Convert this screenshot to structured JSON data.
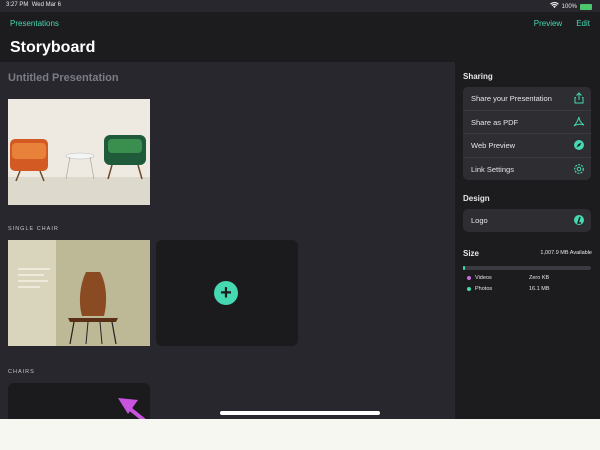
{
  "status": {
    "time": "3:27 PM",
    "date": "Wed Mar 6",
    "battery": "100%"
  },
  "nav": {
    "back_label": "Presentations",
    "preview_label": "Preview",
    "edit_label": "Edit",
    "title": "Storyboard"
  },
  "document": {
    "title": "Untitled Presentation",
    "sections": [
      {
        "label": "SINGLE CHAIR"
      },
      {
        "label": "CHAIRS"
      }
    ],
    "add_label": "+"
  },
  "sidebar": {
    "sharing_heading": "Sharing",
    "sharing_items": [
      {
        "label": "Share your Presentation",
        "icon": "share-icon"
      },
      {
        "label": "Share as PDF",
        "icon": "pdf-icon"
      },
      {
        "label": "Web Preview",
        "icon": "compass-icon"
      },
      {
        "label": "Link Settings",
        "icon": "gear-icon"
      }
    ],
    "design_heading": "Design",
    "design_items": [
      {
        "label": "Logo",
        "icon": "logo-icon"
      }
    ],
    "size_heading": "Size",
    "size_available": "1,007.9 MB Available",
    "usage": [
      {
        "label": "Videos",
        "value": "Zero KB",
        "color": "#c86ee0"
      },
      {
        "label": "Photos",
        "value": "16.1 MB",
        "color": "#46d8b0"
      }
    ]
  },
  "colors": {
    "accent": "#46d8b0",
    "annotation_arrow": "#c954e0"
  }
}
